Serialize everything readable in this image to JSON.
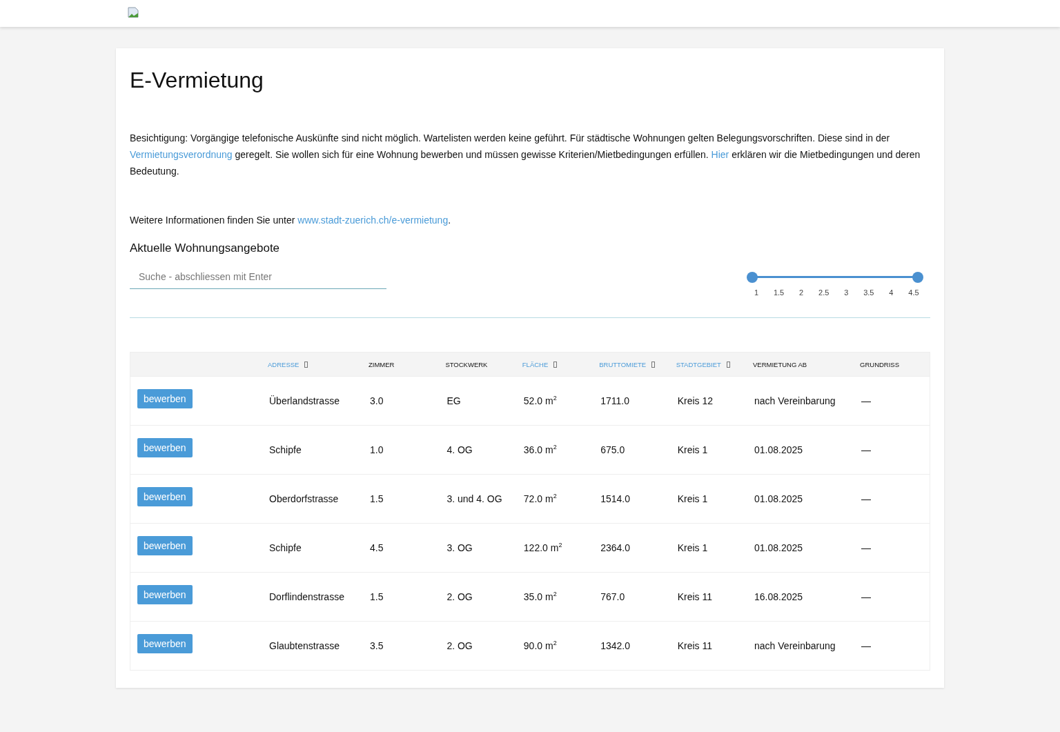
{
  "page": {
    "title": "E-Vermietung",
    "intro": [
      {
        "kind": "text",
        "text": "Besichtigung: Vorgängige telefonische Auskünfte sind nicht möglich. Wartelisten werden keine geführt. Für städtische Wohnungen gelten Belegungsvorschriften. Diese sind in der "
      },
      {
        "kind": "link",
        "text": "Vermietungsverordnung"
      },
      {
        "kind": "text",
        "text": " geregelt. Sie wollen sich für eine Wohnung bewerben und müssen gewisse Kriterien/Mietbedingungen erfüllen. "
      },
      {
        "kind": "link",
        "text": "Hier"
      },
      {
        "kind": "text",
        "text": " erklären wir die Mietbedingungen und deren Bedeutung."
      }
    ],
    "more_info": [
      {
        "kind": "text",
        "text": "Weitere Informationen finden Sie unter "
      },
      {
        "kind": "link",
        "text": "www.stadt-zuerich.ch/e-vermietung"
      },
      {
        "kind": "text",
        "text": "."
      }
    ],
    "section_title": "Aktuelle Wohnungsangebote",
    "search": {
      "placeholder": "Suche - abschliessen mit Enter"
    },
    "rooms_slider": {
      "low": {
        "level": 0
      },
      "high": {
        "level": 1
      },
      "ticks": [
        "1",
        "1.5",
        "2",
        "2.5",
        "3",
        "3.5",
        "4",
        "4.5"
      ]
    },
    "table": {
      "columns": [
        {
          "label": "ADRESSE",
          "sortable": true
        },
        {
          "label": "ZIMMER",
          "sortable": false
        },
        {
          "label": "STOCKWERK",
          "sortable": false
        },
        {
          "label": "FLÄCHE",
          "sortable": true
        },
        {
          "label": "BRUTTOMIETE",
          "sortable": true
        },
        {
          "label": "STADTGEBIET",
          "sortable": true
        },
        {
          "label": "VERMIETUNG AB",
          "sortable": false
        },
        {
          "label": "GRUNDRISS",
          "sortable": false
        }
      ],
      "rows": [
        {
          "action": "bewerben",
          "address": "Überlandstrasse",
          "rooms": "3.0",
          "floor": "EG",
          "area": "52.0 m$^{2}$",
          "rent": "1711.0",
          "district": "Kreis 12",
          "available": "nach Vereinbarung",
          "floor_plan": "—"
        },
        {
          "action": "bewerben",
          "address": "Schipfe",
          "rooms": "1.0",
          "floor": "4. OG",
          "area": "36.0 m$^{2}$",
          "rent": "675.0",
          "district": "Kreis 1",
          "available": "01.08.2025",
          "floor_plan": "—"
        },
        {
          "action": "bewerben",
          "address": "Oberdorfstrasse",
          "rooms": "1.5",
          "floor": "3. und 4. OG",
          "area": "72.0 m$^{2}$",
          "rent": "1514.0",
          "district": "Kreis 1",
          "available": "01.08.2025",
          "floor_plan": "—"
        },
        {
          "action": "bewerben",
          "address": "Schipfe",
          "rooms": "4.5",
          "floor": "3. OG",
          "area": "122.0 m$^{2}$",
          "rent": "2364.0",
          "district": "Kreis 1",
          "available": "01.08.2025",
          "floor_plan": "—"
        },
        {
          "action": "bewerben",
          "address": "Dorflindenstrasse",
          "rooms": "1.5",
          "floor": "2. OG",
          "area": "35.0 m$^{2}$",
          "rent": "767.0",
          "district": "Kreis 11",
          "available": "16.08.2025",
          "floor_plan": "—"
        },
        {
          "action": "bewerben",
          "address": "Glaubtenstrasse",
          "rooms": "3.5",
          "floor": "2. OG",
          "area": "90.0 m$^{2}$",
          "rent": "1342.0",
          "district": "Kreis 11",
          "available": "nach Vereinbarung",
          "floor_plan": "—"
        }
      ]
    }
  }
}
